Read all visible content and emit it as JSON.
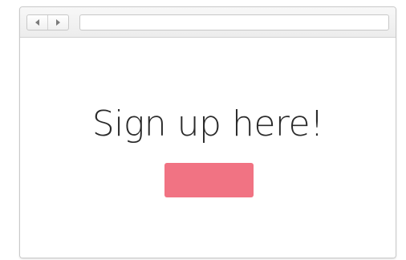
{
  "browser": {
    "nav": {
      "back_icon": "back-arrow-icon",
      "forward_icon": "forward-arrow-icon"
    },
    "address_bar": {
      "value": "",
      "placeholder": ""
    }
  },
  "page": {
    "headline": "Sign up here!",
    "signup_button": {
      "label": "",
      "color": "#f17383"
    }
  },
  "colors": {
    "toolbar_bg": "#f0f0f0",
    "page_bg": "#ffffff",
    "accent": "#f17383"
  }
}
